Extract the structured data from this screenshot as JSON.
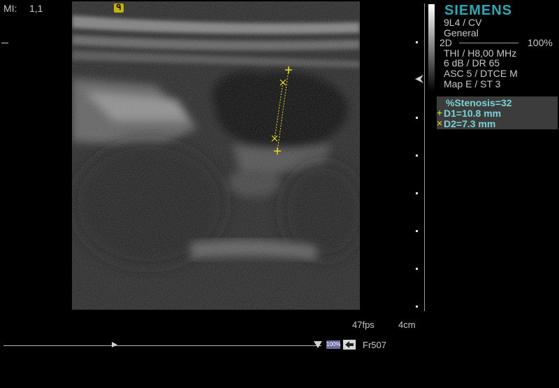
{
  "top_left": {
    "mi_label": "MI:",
    "mi_value": "1,1"
  },
  "orientation_marker": "ᑫ",
  "right_panel": {
    "brand": "SIEMENS",
    "probe": "9L4 / CV",
    "preset": "General",
    "mode": "2D",
    "mode_percent": "100%",
    "line1": "THI / H8,00 MHz",
    "line2": "6 dB / DR 65",
    "line3": "ASC 5 / DTCE M",
    "line4": "Map E / ST 3"
  },
  "measurements": {
    "stenosis": "%Stenosis=32",
    "d1_marker": "+",
    "d1": "D1=10.8 mm",
    "d2_marker": "×",
    "d2": "D2=7.3 mm"
  },
  "bottom": {
    "fps": "47fps",
    "depth": "4cm",
    "zoom_badge": "100%",
    "frame": "Fr507"
  },
  "colors": {
    "brand": "#2aa9b6",
    "measurement_text": "#79d3d8",
    "caliper": "#e8e020"
  }
}
